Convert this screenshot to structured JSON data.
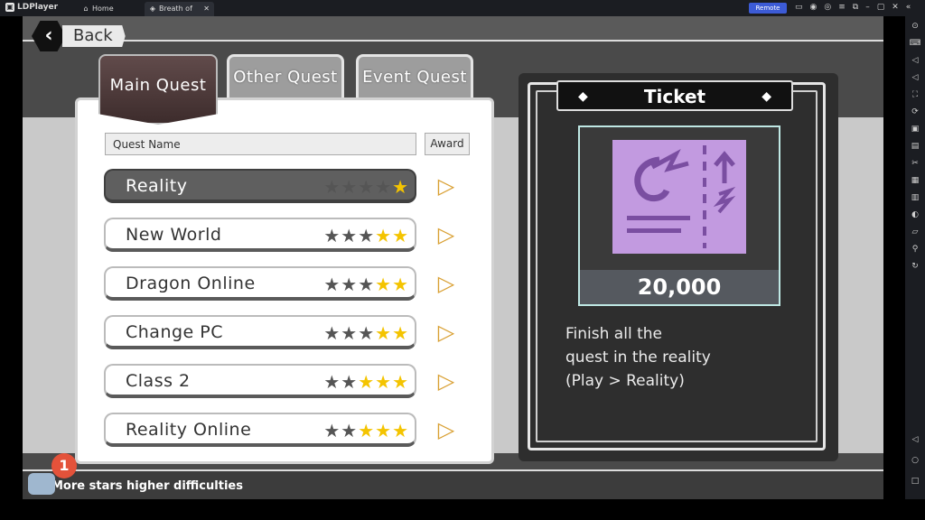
{
  "window": {
    "app_name": "LDPlayer",
    "tabs": [
      {
        "label": "Home",
        "icon": "home-icon"
      },
      {
        "label": "Breath of Dra...",
        "icon": "game-icon"
      }
    ],
    "remote_label": "Remote",
    "remote_color": "#3c5bd6"
  },
  "game": {
    "back_label": "Back",
    "tabs": [
      {
        "label": "Main Quest",
        "active": true
      },
      {
        "label": "Other Quest",
        "active": false
      },
      {
        "label": "Event Quest",
        "active": false
      }
    ],
    "list_header": {
      "name_label": "Quest Name",
      "award_label": "Award"
    },
    "quests": [
      {
        "name": "Reality",
        "stars": 1,
        "selected": true
      },
      {
        "name": "New World",
        "stars": 2,
        "selected": false
      },
      {
        "name": "Dragon Online",
        "stars": 2,
        "selected": false
      },
      {
        "name": "Change PC",
        "stars": 2,
        "selected": false
      },
      {
        "name": "Class 2",
        "stars": 3,
        "selected": false
      },
      {
        "name": "Reality Online",
        "stars": 3,
        "selected": false
      }
    ],
    "ticket": {
      "title": "Ticket",
      "value": "20,000",
      "description": [
        "Finish all the",
        "quest in the reality",
        "(Play > Reality)"
      ]
    },
    "hint": "More stars higher difficulties",
    "notification_count": "1",
    "star_color": "#f4c400",
    "accent_color": "#d9a033"
  }
}
